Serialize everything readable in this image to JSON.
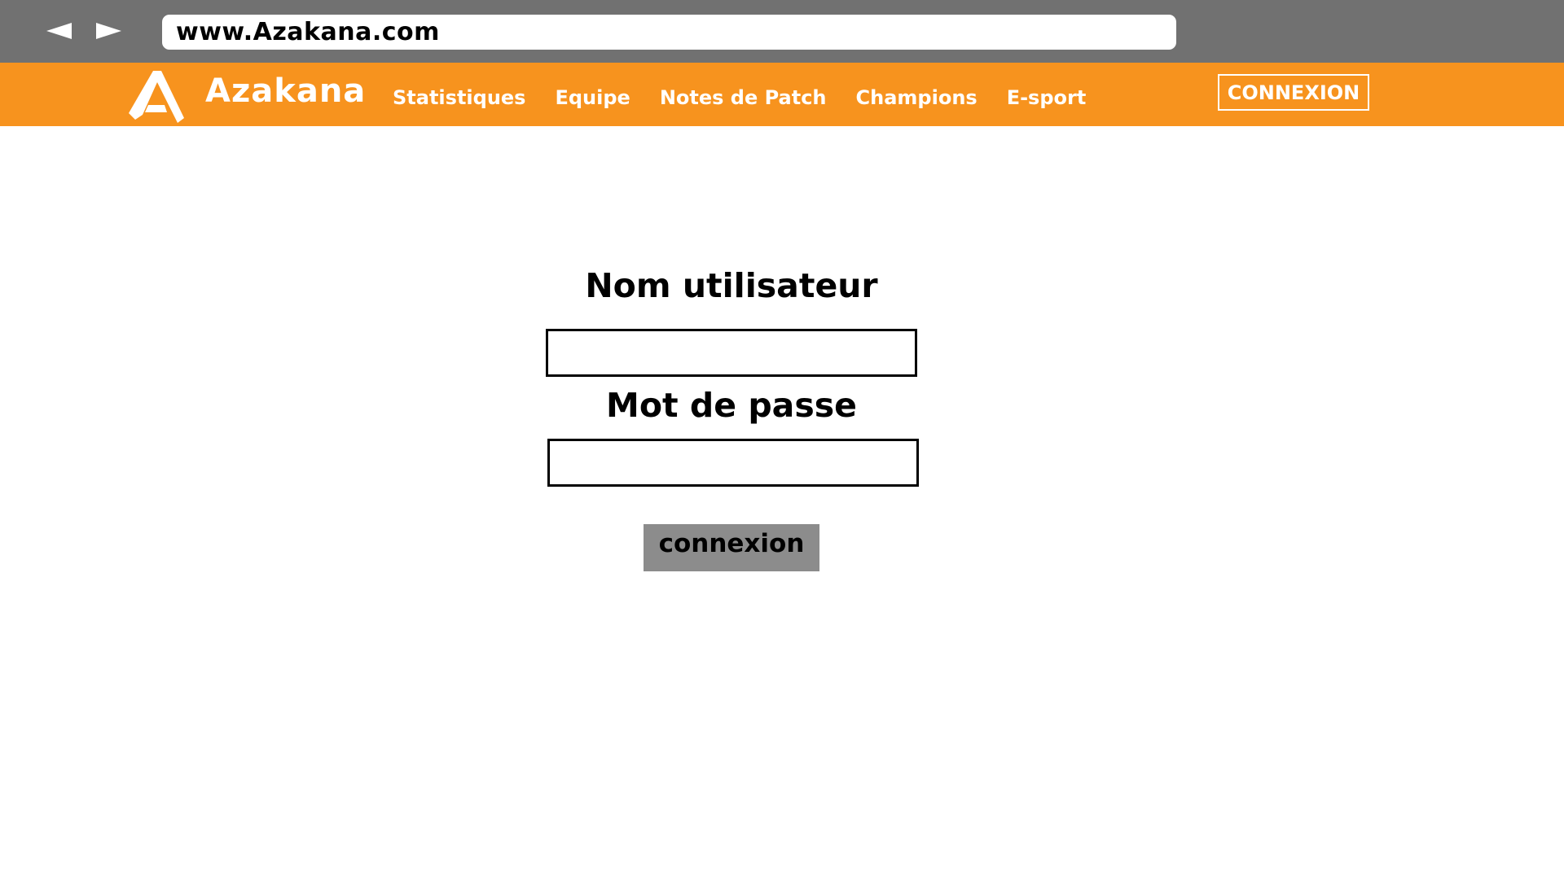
{
  "browser": {
    "url": "www.Azakana.com",
    "back_icon": "back-arrow-icon",
    "forward_icon": "forward-arrow-icon"
  },
  "header": {
    "brand": "Azakana",
    "logo_icon": "azakana-logo-icon",
    "nav": [
      {
        "label": "Statistiques"
      },
      {
        "label": "Equipe"
      },
      {
        "label": "Notes de Patch"
      },
      {
        "label": "Champions"
      },
      {
        "label": "E-sport"
      }
    ],
    "login_label": "CONNEXION"
  },
  "form": {
    "username_label": "Nom utilisateur",
    "username_value": "",
    "password_label": "Mot de passe",
    "password_value": "",
    "submit_label": "connexion"
  },
  "colors": {
    "browser_bar": "#717171",
    "header": "#f7931e",
    "submit_button": "#8c8c8c"
  }
}
